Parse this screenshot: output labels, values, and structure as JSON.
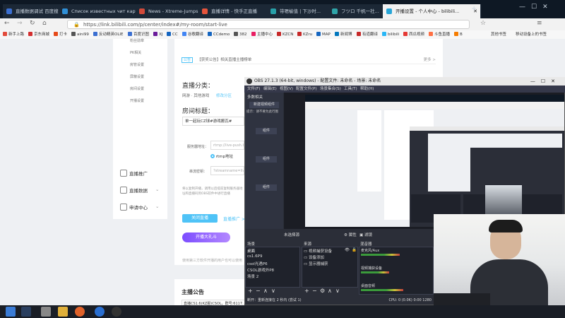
{
  "browser": {
    "tabs": [
      {
        "label": "直播数据调试 百度搜索 - 和网...",
        "color": "#3b6fd1"
      },
      {
        "label": "Список известных чит карт",
        "color": "#2f8fd6"
      },
      {
        "label": "News - Xtreme-Jumps.eu",
        "color": "#d24a3a"
      },
      {
        "label": "直播详情 - 快手正直播",
        "color": "#e5543b"
      },
      {
        "label": "带嗯榆值 | 下沙时...",
        "color": "#28a0a8"
      },
      {
        "label": "フツロ 千帆一社...",
        "color": "#2fa4a8"
      },
      {
        "label": "开播设置 - 个人中心 - bilibili...",
        "color": "#28a6d8"
      }
    ],
    "url": "https://link.bilibili.com/p/center/index#/my-room/start-live",
    "bookmarks": [
      {
        "label": "新手上路",
        "color": "#e24b3b"
      },
      {
        "label": "京东商城",
        "color": "#d32f2f"
      },
      {
        "label": "打卡",
        "color": "#e64a19"
      },
      {
        "label": "aini99",
        "color": "#555555"
      },
      {
        "label": "反动精英OLIE",
        "color": "#3b6fd1"
      },
      {
        "label": "百度识图",
        "color": "#3b6fd1"
      },
      {
        "label": "XJ",
        "color": "#6a1b9a"
      },
      {
        "label": "CC",
        "color": "#1565c0"
      },
      {
        "label": "谷歌翻译",
        "color": "#4285f4"
      },
      {
        "label": "CCdemo",
        "color": "#1565c0"
      },
      {
        "label": "382",
        "color": "#555555"
      },
      {
        "label": "主播中心",
        "color": "#e91e63"
      },
      {
        "label": "KZCN",
        "color": "#c62828"
      },
      {
        "label": "KZru",
        "color": "#c62828"
      },
      {
        "label": "MAP",
        "color": "#1565c0"
      },
      {
        "label": "新闻博",
        "color": "#0277bd"
      },
      {
        "label": "有道翻译",
        "color": "#c62828"
      },
      {
        "label": "bilibili",
        "color": "#29b6f6"
      },
      {
        "label": "西瓜视频",
        "color": "#e53935"
      },
      {
        "label": "斗鱼直播",
        "color": "#ff7043"
      },
      {
        "label": "B",
        "color": "#f57c00"
      }
    ],
    "bookmark_right": [
      "其他书签",
      "移动设备上的书签"
    ]
  },
  "bilibili": {
    "sidebar_sub": [
      "粉丝勋章",
      "PK相关",
      "房管设置",
      "屏蔽设置",
      "房间设置",
      "开播设置"
    ],
    "sidebar_menu": [
      "直播推广",
      "直播数据",
      "申请中心"
    ],
    "notice_tag": "公告",
    "notice_text": "【获奖公告】相关直播主播榜单",
    "notice_more": "更多 >",
    "category_title": "直播分类：",
    "category_path": "网游 · 其他游戏",
    "category_change": "修改分区",
    "room_title_label": "房间标题：",
    "room_title_value": "单一起玩CZ球#游戏搬瓦#",
    "server_label": "服务器地址：",
    "server_value": "rtmp://live-push.bi...",
    "rtmp_option": "rtmp地址",
    "key_label": "串流密钥：",
    "key_value": "?streamname=live_...",
    "tip_text": "将以复制开播，调用以后提前复制服务器地址和直播码到OBS软件中进行直播",
    "close_live": "关闭直播",
    "promote": "直播推广 >",
    "event_badge": "开播大礼斗",
    "footer_tip": "使用第三方软件开播的用户也可以使用",
    "announce_title": "主播公告",
    "announce_text": "直播CS1.6(KZ服)CSOL，群号:6117..."
  },
  "obs": {
    "title": "OBS 27.1.3 (64-bit, windows) - 配置文件: 未命名 - 场景: 未命名",
    "menu": [
      "文件(F)",
      "编辑(E)",
      "视图(V)",
      "配置文件(P)",
      "场景集合(S)",
      "工具(T)",
      "帮助(H)"
    ],
    "left_panel_title": "多数相关",
    "left_buttons": [
      "新建视频组件",
      "提示：请不要为此行图",
      "组件",
      "组件",
      "组件"
    ],
    "no_source": "未选择源",
    "props": "属性",
    "filters": "滤镜",
    "scenes_title": "场景",
    "scenes": [
      "桌面",
      "cs1.6P9",
      "csol光遇P6",
      "CSOL游戏外P8",
      "场景 2"
    ],
    "sources_title": "来源",
    "sources": [
      "视频捕获设备",
      "设备添加",
      "显示器捕获"
    ],
    "mixer_title": "混音器",
    "mixer": [
      {
        "name": "麦克风/Aux",
        "level": 0.55
      },
      {
        "name": "视频捕获设备",
        "level": 0.4
      },
      {
        "name": "桌面音频",
        "level": 0.6
      }
    ],
    "status": "断开：重新连接在 2 秒内 (尝试 1)",
    "status_right": "CPU: 0 (0.0K)  0:00  1280"
  },
  "taskbar": {
    "icons": [
      {
        "name": "start",
        "color": "#3a7bd5"
      },
      {
        "name": "steam",
        "color": "#2a3f5f"
      },
      {
        "name": "folder",
        "color": "#e0b03a"
      },
      {
        "name": "firefox",
        "color": "#e0622a"
      },
      {
        "name": "chrome",
        "color": "#4285f4"
      },
      {
        "name": "k",
        "color": "#2a6fd1"
      },
      {
        "name": "obs",
        "color": "#333333"
      }
    ]
  }
}
